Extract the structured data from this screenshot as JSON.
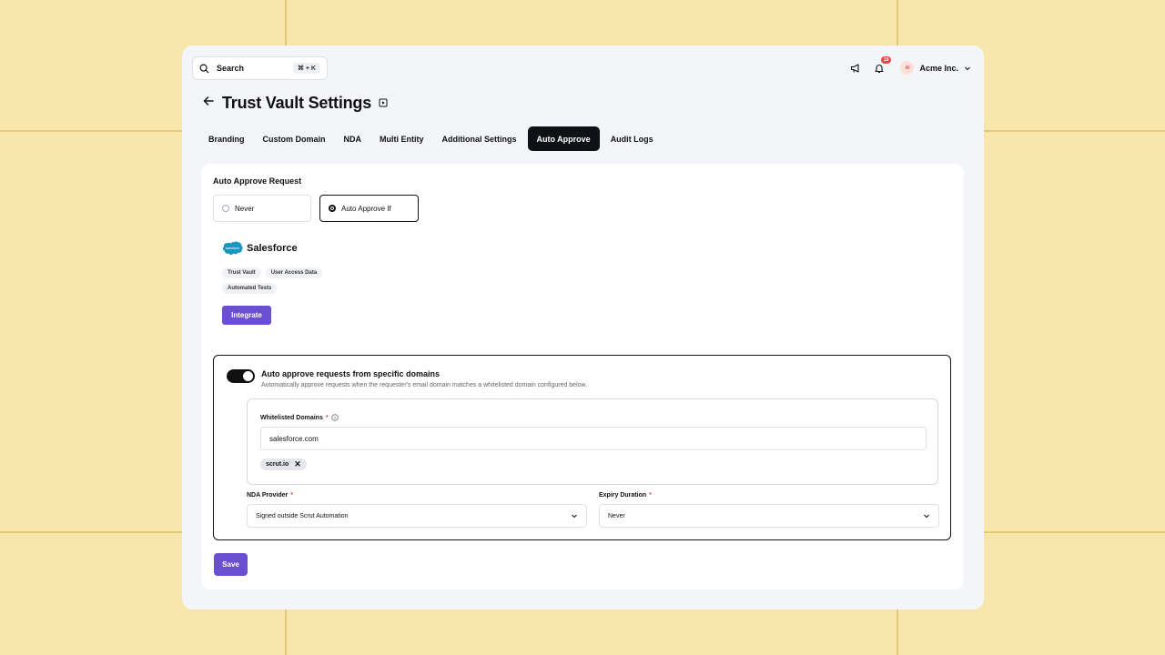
{
  "search": {
    "label": "Search",
    "shortcut": "⌘ + K"
  },
  "topbar": {
    "notification_count": "19",
    "avatar_initials": "AI",
    "org_name": "Acme Inc."
  },
  "page": {
    "title": "Trust Vault Settings"
  },
  "tabs": [
    {
      "label": "Branding"
    },
    {
      "label": "Custom Domain"
    },
    {
      "label": "NDA"
    },
    {
      "label": "Multi Entity"
    },
    {
      "label": "Additional Settings"
    },
    {
      "label": "Auto Approve",
      "active": true
    },
    {
      "label": "Audit Logs"
    }
  ],
  "auto_approve": {
    "section_label": "Auto Approve Request",
    "options": [
      {
        "label": "Never",
        "selected": false
      },
      {
        "label": "Auto Approve If",
        "selected": true
      }
    ]
  },
  "integration": {
    "logo_text": "salesforce",
    "name": "Salesforce",
    "chips": [
      "Trust Vault",
      "User Access Data",
      "Automated Tests"
    ],
    "button_label": "Integrate"
  },
  "domains": {
    "toggle_on": true,
    "title": "Auto approve requests from specific domains",
    "description": "Automatically approve requests when the requester's email domain matches a whitelisted domain configured below.",
    "whitelist_label": "Whitelisted Domains",
    "required_mark": "*",
    "input_value": "salesforce.com",
    "tags": [
      "scrut.io"
    ],
    "remove_symbol": "✕"
  },
  "nda": {
    "label": "NDA Provider",
    "value": "Signed outside Scrut Automation"
  },
  "expiry": {
    "label": "Expiry Duration",
    "value": "Never"
  },
  "actions": {
    "save_label": "Save"
  },
  "colors": {
    "accent": "#6a4fd1",
    "active_tab": "#0e1116",
    "background": "#f8e7ad",
    "badge": "#e5484d"
  }
}
